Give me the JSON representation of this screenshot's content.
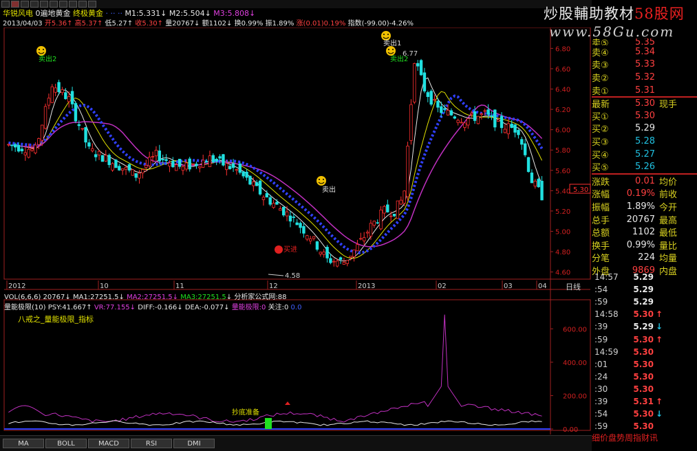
{
  "watermark": {
    "title_pre": "炒股輔助教材",
    "title_site": "58股网",
    "url": "www.58Gu.com"
  },
  "header": {
    "stock_name": "华锐风电",
    "formula": "0遍地黄金",
    "formula2": "终极黄金",
    "m1": "M1:5.331",
    "m2": "M2:5.504",
    "m3": "M3:5.808"
  },
  "quote_line": {
    "date": "2013/04/03",
    "open": "开5.36",
    "high": "高5.37",
    "low": "低5.27",
    "close": "收5.30",
    "volume": "量20767",
    "amount": "额1102",
    "turnover": "换0.99%",
    "amplitude": "振1.89%",
    "change": "涨(0.01)0.19%",
    "index": "指数(-99.00)-4.26%"
  },
  "price_axis": [
    "6.80",
    "6.60",
    "6.40",
    "6.20",
    "6.00",
    "5.80",
    "5.60",
    "5.40",
    "5.20",
    "5.00",
    "4.80",
    "4.60"
  ],
  "current_price_tag": "5.30",
  "date_axis": [
    "2012",
    "10",
    "11",
    "12",
    "2013",
    "02",
    "03",
    "04"
  ],
  "period_label": "日线",
  "annotations": {
    "sell2": "卖出2",
    "sell1": "卖出1",
    "sell2b": "卖出2",
    "buy_in": "买进",
    "sell_mid": "卖出",
    "low_price": "4.58",
    "hi_price": "6.77",
    "bottom_prep": "抄底准备"
  },
  "vol_line": {
    "name": "VOL(6,6,6)",
    "value": "20767",
    "ma1": "MA1:27251.5",
    "ma2": "MA2:27251.5",
    "ma3": "MA3:27251.5",
    "site": "分析家公式网:88"
  },
  "ind_line": {
    "name": "量能极限(10)",
    "psy": "PSY:41.667",
    "vr": "VR:77.155",
    "diff": "DIFF:-0.166",
    "dea": "DEA:-0.077",
    "limit": "量能极限:0",
    "focus": "关注:0",
    "zero": "0.0"
  },
  "ind_title": "八戒之_量能极限_指标",
  "ind_axis": [
    "600.00",
    "400.00",
    "200.00",
    "0.00"
  ],
  "tabs": [
    "MA",
    "BOLL",
    "MACD",
    "RSI",
    "DMI"
  ],
  "order_book": {
    "top_partial": {
      "label": "卖⑤",
      "price": "5.35"
    },
    "asks": [
      {
        "label": "卖④",
        "price": "5.34"
      },
      {
        "label": "卖③",
        "price": "5.33"
      },
      {
        "label": "卖②",
        "price": "5.32"
      },
      {
        "label": "卖①",
        "price": "5.31"
      }
    ],
    "latest": {
      "label": "最新",
      "price": "5.30",
      "side": "现手"
    },
    "bids": [
      {
        "label": "买①",
        "price": "5.30"
      },
      {
        "label": "买②",
        "price": "5.29"
      },
      {
        "label": "买③",
        "price": "5.28"
      },
      {
        "label": "买④",
        "price": "5.27"
      },
      {
        "label": "买⑤",
        "price": "5.26"
      }
    ]
  },
  "stats": [
    {
      "l1": "涨跌",
      "v1": "0.01",
      "l2": "均价",
      "c": "red"
    },
    {
      "l1": "涨幅",
      "v1": "0.19%",
      "l2": "前收",
      "c": "red"
    },
    {
      "l1": "振幅",
      "v1": "1.89%",
      "l2": "今开",
      "c": "white"
    },
    {
      "l1": "总手",
      "v1": "20767",
      "l2": "最高",
      "c": "white"
    },
    {
      "l1": "总额",
      "v1": "1102",
      "l2": "最低",
      "c": "white"
    },
    {
      "l1": "换手",
      "v1": "0.99%",
      "l2": "量比",
      "c": "white"
    },
    {
      "l1": "分笔",
      "v1": "224",
      "l2": "均量",
      "c": "white"
    },
    {
      "l1": "外盘",
      "v1": "9869",
      "l2": "内盘",
      "c": "red"
    }
  ],
  "ticks": [
    {
      "time": "14:57",
      "price": "5.29",
      "arrow": "",
      "c": "white"
    },
    {
      "time": ":54",
      "price": "5.29",
      "arrow": "",
      "c": "white"
    },
    {
      "time": ":59",
      "price": "5.29",
      "arrow": "",
      "c": "white"
    },
    {
      "time": "14:58",
      "price": "5.30",
      "arrow": "↑",
      "c": "red"
    },
    {
      "time": ":39",
      "price": "5.29",
      "arrow": "↓",
      "c": "white"
    },
    {
      "time": ":59",
      "price": "5.30",
      "arrow": "↑",
      "c": "red"
    },
    {
      "time": "14:59",
      "price": "5.30",
      "arrow": "",
      "c": "red"
    },
    {
      "time": ":01",
      "price": "5.30",
      "arrow": "",
      "c": "red"
    },
    {
      "time": ":24",
      "price": "5.30",
      "arrow": "",
      "c": "red"
    },
    {
      "time": ":30",
      "price": "5.30",
      "arrow": "",
      "c": "red"
    },
    {
      "time": ":39",
      "price": "5.31",
      "arrow": "↑",
      "c": "red"
    },
    {
      "time": ":54",
      "price": "5.30",
      "arrow": "↓",
      "c": "red"
    },
    {
      "time": ":59",
      "price": "5.30",
      "arrow": "",
      "c": "red"
    }
  ],
  "bottom_tabs": "细价盘势周指财讯",
  "colors": {
    "up": "#ff3030",
    "down": "#20e0e0",
    "ma_white": "#e8e8e8",
    "ma_yellow": "#e0e000",
    "ma_purple": "#c030c0",
    "ma_blue": "#3040ff"
  }
}
